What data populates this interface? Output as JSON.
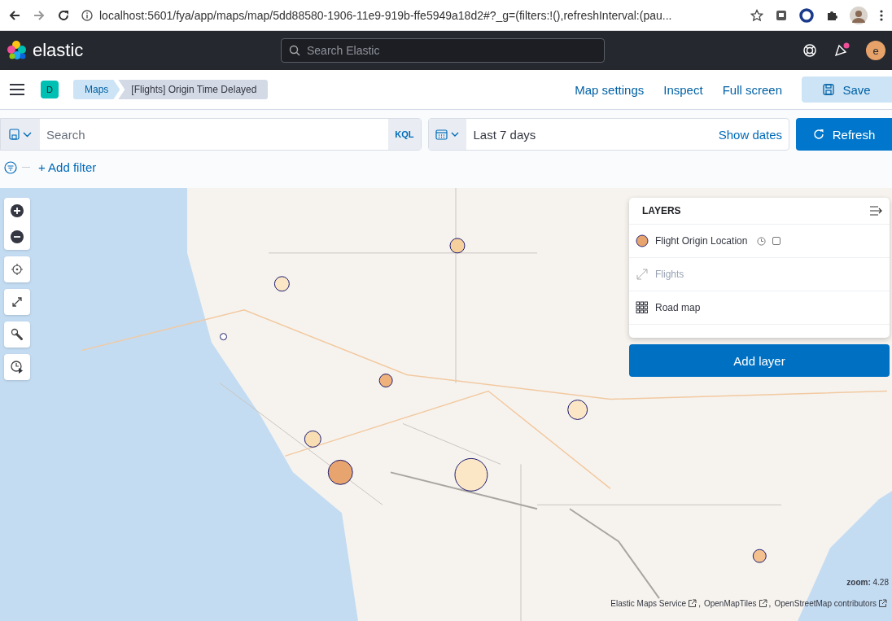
{
  "browser": {
    "url": "localhost:5601/fya/app/maps/map/5dd88580-1906-11e9-919b-ffe5949a18d2#?_g=(filters:!(),refreshInterval:(pau..."
  },
  "header": {
    "logo_text": "elastic",
    "search": {
      "placeholder": "Search Elastic"
    },
    "notification_badge": true,
    "avatar_letter": "e"
  },
  "nav": {
    "space_letter": "D",
    "breadcrumbs": [
      {
        "label": "Maps",
        "selected": false
      },
      {
        "label": "[Flights] Origin Time Delayed",
        "selected": true
      }
    ],
    "actions": [
      "Map settings",
      "Inspect",
      "Full screen"
    ],
    "save_label": "Save"
  },
  "query": {
    "search": {
      "placeholder": "Search"
    },
    "language": "KQL",
    "date_range": "Last 7 days",
    "show_dates": "Show dates",
    "refresh_label": "Refresh",
    "add_filter": "+ Add filter"
  },
  "map": {
    "kind": "picture",
    "layers_panel": {
      "title": "LAYERS",
      "layers": [
        {
          "kind": "points",
          "name": "Flight Origin Location",
          "color": "#e8a46e",
          "hidden": false,
          "time_aware": true
        },
        {
          "kind": "lines",
          "name": "Flights",
          "hidden": true,
          "time_aware": false
        },
        {
          "kind": "tiles",
          "name": "Road map",
          "hidden": false,
          "time_aware": false
        }
      ],
      "add_layer": "Add layer"
    },
    "zoom": "**zoom:** 4.28",
    "attribution": [
      "Elastic Maps Service",
      "OpenMapTiles",
      "OpenStreetMap contributors"
    ],
    "attribution_separator": ","
  }
}
